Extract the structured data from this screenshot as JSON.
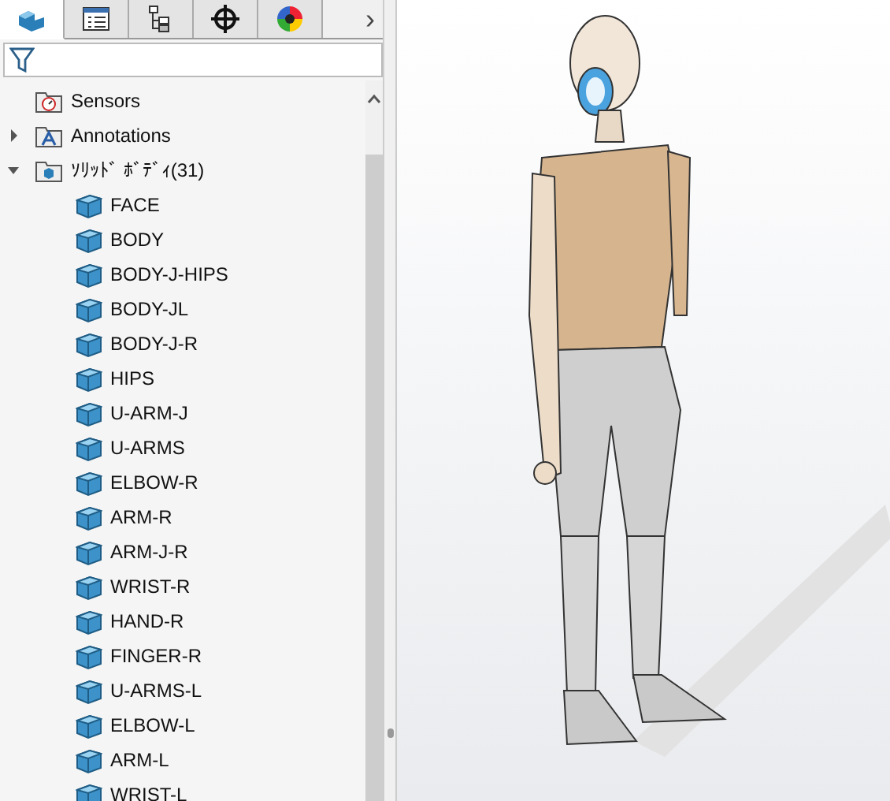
{
  "tabs": [
    {
      "kind": "part",
      "selected": true
    },
    {
      "kind": "properties",
      "selected": false
    },
    {
      "kind": "configurations",
      "selected": false
    },
    {
      "kind": "target",
      "selected": false
    },
    {
      "kind": "appearance",
      "selected": false
    }
  ],
  "tab_scroll": {
    "label": "›"
  },
  "tree": [
    {
      "label": "Sensors",
      "kind": "sensors"
    },
    {
      "label": "Annotations",
      "kind": "annotations",
      "expanded": false
    },
    {
      "label": "ｿﾘｯﾄﾞ ﾎﾞﾃﾞｨ(31)",
      "kind": "bodies",
      "expanded": true,
      "children": [
        {
          "label": "FACE"
        },
        {
          "label": "BODY"
        },
        {
          "label": "BODY-J-HIPS"
        },
        {
          "label": "BODY-JL"
        },
        {
          "label": "BODY-J-R"
        },
        {
          "label": "HIPS"
        },
        {
          "label": "U-ARM-J"
        },
        {
          "label": "U-ARMS"
        },
        {
          "label": "ELBOW-R"
        },
        {
          "label": "ARM-R"
        },
        {
          "label": "ARM-J-R"
        },
        {
          "label": "WRIST-R"
        },
        {
          "label": "HAND-R"
        },
        {
          "label": "FINGER-R"
        },
        {
          "label": "U-ARMS-L"
        },
        {
          "label": "ELBOW-L"
        },
        {
          "label": "ARM-L"
        },
        {
          "label": "WRIST-L"
        }
      ]
    }
  ]
}
